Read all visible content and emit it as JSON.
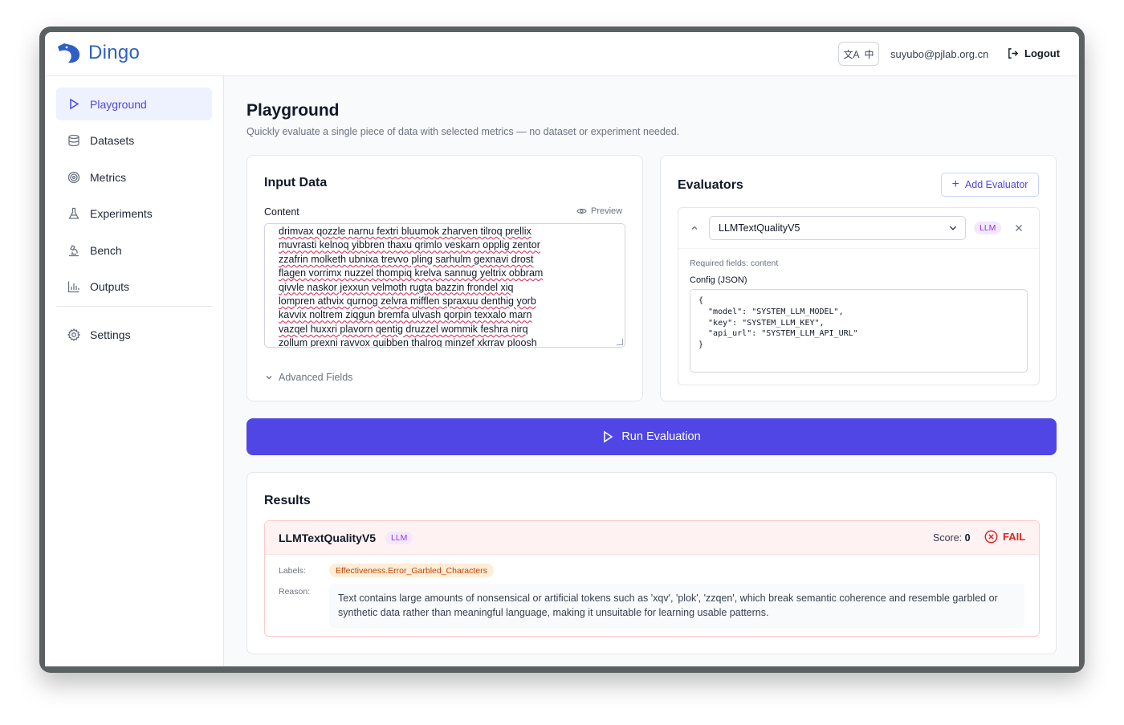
{
  "header": {
    "logo_text": "Dingo",
    "lang_label": "中",
    "user_email": "suyubo@pjlab.org.cn",
    "logout_label": "Logout"
  },
  "sidebar": {
    "items": [
      {
        "label": "Playground",
        "icon": "play-icon",
        "active": true
      },
      {
        "label": "Datasets",
        "icon": "database-icon"
      },
      {
        "label": "Metrics",
        "icon": "target-icon"
      },
      {
        "label": "Experiments",
        "icon": "flask-icon"
      },
      {
        "label": "Bench",
        "icon": "microscope-icon"
      },
      {
        "label": "Outputs",
        "icon": "bar-chart-icon"
      },
      {
        "label": "Settings",
        "icon": "gear-icon"
      }
    ]
  },
  "main": {
    "title": "Playground",
    "subtitle": "Quickly evaluate a single piece of data with selected metrics — no dataset or experiment needed.",
    "input": {
      "title": "Input Data",
      "content_label": "Content",
      "preview_label": "Preview",
      "content_lines": [
        "drimvax qozzle narnu fextri bluumok zharven tilroq prellix",
        "muvrasti kelnoq yibbren thaxu qrimlo veskarn opplig zentor",
        "zzafrin molketh ubnixa trevvo pling sarhulm gexnavi drost",
        "flagen vorrimx nuzzel thompiq krelva sannug yeltrix obbram",
        "qivvle naskor jexxun velmoth rugta bazzin frondel xiq",
        "lompren athvix qurnog zelvra mifflen spraxuu denthig yorb",
        "kavvix noltrem ziqgun bremfa ulvash qorpin texxalo marn",
        "vazqel huxxri plavorn qentig druzzel wommik feshra nirq",
        "zollum prexni ravvox quibben thalrog minzef xkrrav ploosh"
      ],
      "advanced_label": "Advanced Fields"
    },
    "evaluators": {
      "title": "Evaluators",
      "add_label": "Add Evaluator",
      "selected": "LLMTextQualityV5",
      "badge": "LLM",
      "required_fields": "Required fields: content",
      "config_label": "Config (JSON)",
      "config_json": "{\n  \"model\": \"SYSTEM_LLM_MODEL\",\n  \"key\": \"SYSTEM_LLM_KEY\",\n  \"api_url\": \"SYSTEM_LLM_API_URL\"\n}"
    },
    "run_label": "Run Evaluation",
    "results": {
      "title": "Results",
      "name": "LLMTextQualityV5",
      "badge": "LLM",
      "score_label": "Score:",
      "score_value": "0",
      "status": "FAIL",
      "labels_label": "Labels:",
      "label_value": "Effectiveness.Error_Garbled_Characters",
      "reason_label": "Reason:",
      "reason_text": "Text contains large amounts of nonsensical or artificial tokens such as 'xqv', 'plok', 'zzqen', which break semantic coherence and resemble garbled or synthetic data rather than meaningful language, making it unsuitable for learning usable patterns."
    }
  },
  "colors": {
    "accent": "#4f46e5",
    "logo": "#2f5fc4",
    "fail": "#dc2626",
    "llm_badge": "#9333ea",
    "label_badge": "#c2410c"
  }
}
